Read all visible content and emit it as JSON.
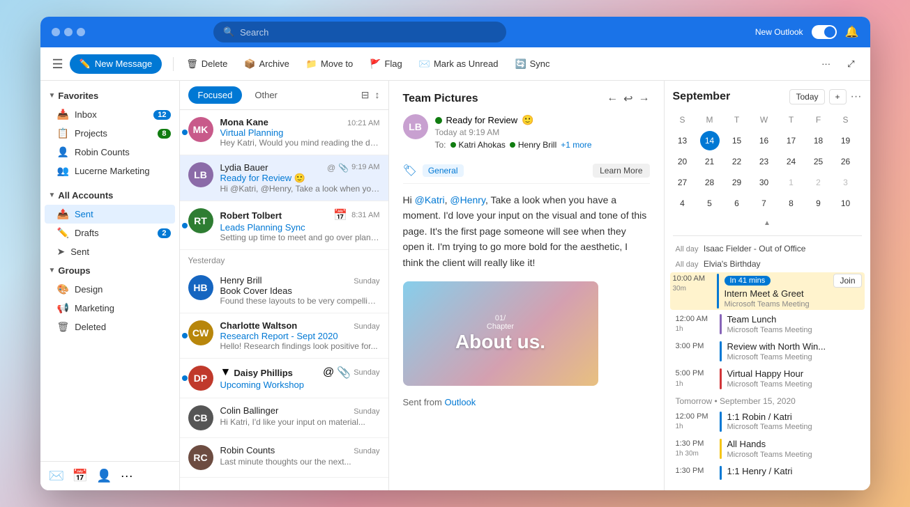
{
  "titlebar": {
    "search_placeholder": "Search",
    "new_outlook": "New Outlook",
    "window_controls": [
      "",
      "",
      ""
    ]
  },
  "toolbar": {
    "hamburger": "☰",
    "new_message": "New Message",
    "delete": "Delete",
    "archive": "Archive",
    "move_to": "Move to",
    "flag": "Flag",
    "mark_as_unread": "Mark as Unread",
    "sync": "Sync"
  },
  "sidebar": {
    "favorites_label": "Favorites",
    "inbox_label": "Inbox",
    "inbox_badge": "12",
    "projects_label": "Projects",
    "projects_badge": "8",
    "robin_counts": "Robin Counts",
    "lucerne_marketing": "Lucerne Marketing",
    "all_accounts_label": "All Accounts",
    "sent_label": "Sent",
    "drafts_label": "Drafts",
    "drafts_badge": "2",
    "sent_sub_label": "Sent",
    "groups_label": "Groups",
    "design_label": "Design",
    "marketing_label": "Marketing",
    "deleted_label": "Deleted"
  },
  "email_list": {
    "tab_focused": "Focused",
    "tab_other": "Other",
    "emails": [
      {
        "sender": "Mona Kane",
        "subject": "Virtual Planning",
        "preview": "Hey Katri, Would you mind reading the draft...",
        "time": "10:21 AM",
        "unread": true,
        "avatar_color": "#c85a8a",
        "avatar_initials": "MK"
      },
      {
        "sender": "Lydia Bauer",
        "subject": "Ready for Review 🙂",
        "preview": "Hi @Katri, @Henry, Take a look when you have...",
        "time": "9:19 AM",
        "unread": false,
        "avatar_color": "#8b6ba8",
        "avatar_initials": "LB",
        "selected": true
      },
      {
        "sender": "Robert Tolbert",
        "subject": "Leads Planning Sync",
        "preview": "Setting up time to meet and go over planning...",
        "time": "8:31 AM",
        "unread": true,
        "avatar_color": "#2e7d32",
        "avatar_initials": "RT"
      }
    ],
    "yesterday_label": "Yesterday",
    "yesterday_emails": [
      {
        "sender": "Henry Brill",
        "subject": "Book Cover Ideas",
        "preview": "Found these layouts to be very compelling...",
        "time": "Sunday",
        "avatar_color": "#1565c0",
        "avatar_initials": "HB"
      },
      {
        "sender": "Charlotte Waltson",
        "subject": "Research Report - Sept 2020",
        "preview": "Hello! Research findings look positive for...",
        "time": "Sunday",
        "unread": true,
        "avatar_color": "#b8860b",
        "avatar_initials": "CW"
      },
      {
        "sender": "Daisy Phillips",
        "subject": "Upcoming Workshop",
        "preview": "",
        "time": "Sunday",
        "unread": true,
        "avatar_color": "#c0392b",
        "avatar_initials": "DP"
      },
      {
        "sender": "Colin Ballinger",
        "subject": "",
        "preview": "Hi Katri, I'd like your input on material...",
        "time": "Sunday",
        "avatar_color": "#555",
        "avatar_initials": "CB"
      },
      {
        "sender": "Robin Counts",
        "subject": "",
        "preview": "Last minute thoughts our the next...",
        "time": "Sunday",
        "avatar_color": "#6d4c41",
        "avatar_initials": "RC"
      }
    ]
  },
  "email_body": {
    "title": "Team Pictures",
    "status": "Ready for Review",
    "emoji": "🙂",
    "time": "Today at 9:19 AM",
    "to_label": "To:",
    "recipient1": "Katri Ahokas",
    "recipient2": "Henry Brill",
    "plus_more": "+1 more",
    "tag": "General",
    "learn_more": "Learn More",
    "body_text": "Hi @Katri, @Henry, Take a look when you have a moment. I'd love your input on the visual and tone of this page. It's the first page someone will see when they open it. I'm trying to go more bold for the aesthetic, I think the client will really like it!",
    "image_chapter": "01/\nChapter",
    "image_about": "About us.",
    "sent_from": "Sent from",
    "outlook_link": "Outlook"
  },
  "calendar": {
    "month": "September",
    "today_btn": "Today",
    "days_header": [
      "S",
      "M",
      "T",
      "W",
      "T",
      "F",
      "S"
    ],
    "weeks": [
      [
        {
          "n": "13",
          "cls": ""
        },
        {
          "n": "14",
          "cls": "today"
        },
        {
          "n": "15",
          "cls": ""
        },
        {
          "n": "16",
          "cls": ""
        },
        {
          "n": "17",
          "cls": ""
        },
        {
          "n": "18",
          "cls": ""
        },
        {
          "n": "19",
          "cls": ""
        }
      ],
      [
        {
          "n": "20",
          "cls": ""
        },
        {
          "n": "21",
          "cls": ""
        },
        {
          "n": "22",
          "cls": ""
        },
        {
          "n": "23",
          "cls": ""
        },
        {
          "n": "24",
          "cls": ""
        },
        {
          "n": "25",
          "cls": ""
        },
        {
          "n": "26",
          "cls": ""
        }
      ],
      [
        {
          "n": "27",
          "cls": ""
        },
        {
          "n": "28",
          "cls": ""
        },
        {
          "n": "29",
          "cls": ""
        },
        {
          "n": "30",
          "cls": ""
        },
        {
          "n": "1",
          "cls": "other-month"
        },
        {
          "n": "2",
          "cls": "other-month"
        },
        {
          "n": "3",
          "cls": "other-month"
        }
      ],
      [
        {
          "n": "4",
          "cls": ""
        },
        {
          "n": "5",
          "cls": ""
        },
        {
          "n": "6",
          "cls": ""
        },
        {
          "n": "7",
          "cls": ""
        },
        {
          "n": "8",
          "cls": ""
        },
        {
          "n": "9",
          "cls": ""
        },
        {
          "n": "10",
          "cls": ""
        }
      ]
    ],
    "all_day_label": "All day",
    "all_day_events": [
      "Isaac Fielder - Out of Office",
      "Elvia's Birthday"
    ],
    "events": [
      {
        "time": "10:00 AM",
        "duration": "30m",
        "title": "Intern Meet & Greet",
        "subtitle": "Microsoft Teams Meeting",
        "bar_color": "blue",
        "badge": "In 41 mins",
        "has_join": true
      },
      {
        "time": "12:00 AM",
        "duration": "1h",
        "title": "Team Lunch",
        "subtitle": "Microsoft Teams Meeting",
        "bar_color": "purple"
      },
      {
        "time": "3:00 PM",
        "duration": "",
        "title": "Review with North Win...",
        "subtitle": "Microsoft Teams Meeting",
        "bar_color": "blue"
      },
      {
        "time": "5:00 PM",
        "duration": "1h",
        "title": "Virtual Happy Hour",
        "subtitle": "Microsoft Teams Meeting",
        "bar_color": "pink"
      }
    ],
    "tomorrow_label": "Tomorrow • September 15, 2020",
    "tomorrow_events": [
      {
        "time": "12:00 PM",
        "duration": "1h",
        "title": "1:1 Robin / Katri",
        "subtitle": "Microsoft Teams Meeting",
        "bar_color": "blue"
      },
      {
        "time": "1:30 PM",
        "duration": "1h 30m",
        "title": "All Hands",
        "subtitle": "Microsoft Teams Meeting",
        "bar_color": "yellow"
      },
      {
        "time": "1:30 PM",
        "duration": "",
        "title": "1:1 Henry / Katri",
        "subtitle": "",
        "bar_color": "blue"
      }
    ]
  },
  "bottom_nav": {
    "mail": "✉",
    "calendar": "📅",
    "contacts": "👤",
    "more": "···"
  }
}
